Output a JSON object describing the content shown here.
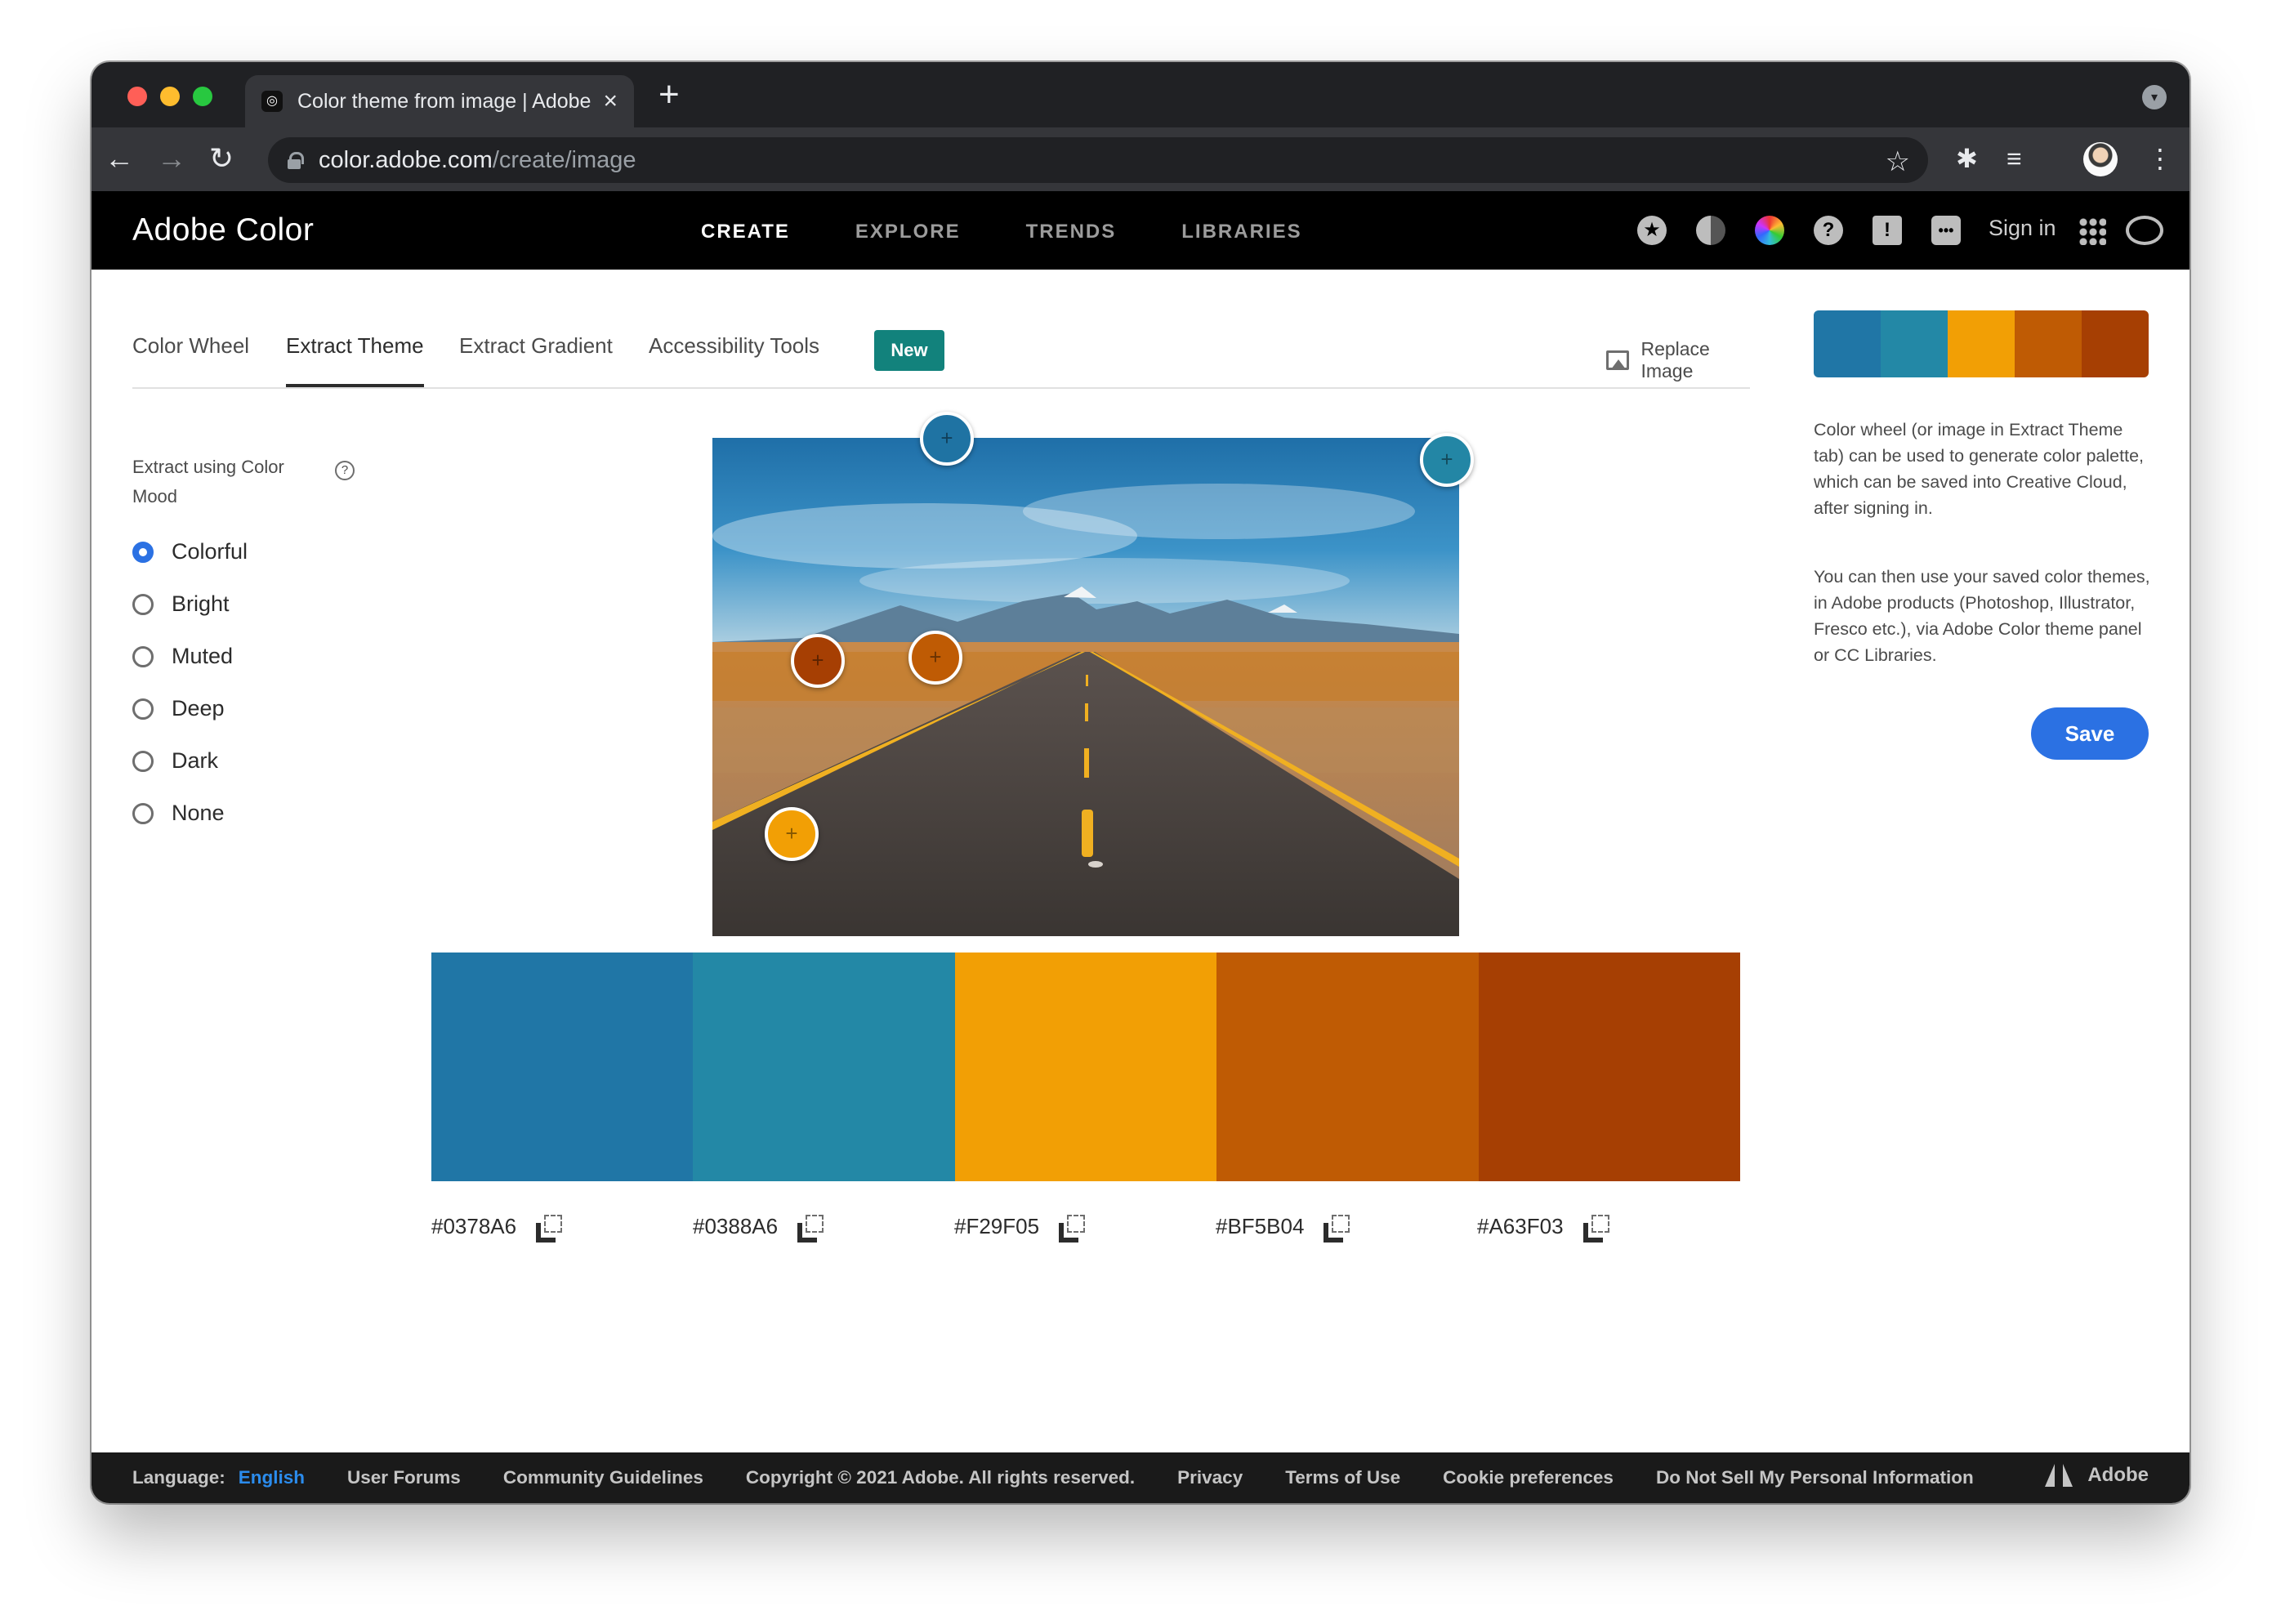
{
  "browser": {
    "tab_title": "Color theme from image | Adobe Color",
    "tab_favicon": "adobe-color-icon",
    "new_tab_label": "+",
    "url_host": "color.adobe.com",
    "url_path": "/create/image"
  },
  "header": {
    "brand": "Adobe Color",
    "nav": [
      "CREATE",
      "EXPLORE",
      "TRENDS",
      "LIBRARIES"
    ],
    "active_nav": "CREATE",
    "sign_in": "Sign in",
    "icons": [
      "star-badge-icon",
      "moon-icon",
      "color-wheel-icon",
      "help-icon",
      "feedback-icon",
      "chat-icon",
      "apps-grid-icon",
      "creative-cloud-icon"
    ]
  },
  "subtabs": {
    "items": [
      "Color Wheel",
      "Extract Theme",
      "Extract Gradient",
      "Accessibility Tools"
    ],
    "active": "Extract Theme",
    "new_badge": "New",
    "replace_image": "Replace Image"
  },
  "mood": {
    "label": "Extract using Color Mood",
    "help": "?",
    "options": [
      "Colorful",
      "Bright",
      "Muted",
      "Deep",
      "Dark",
      "None"
    ],
    "selected": "Colorful"
  },
  "theme": {
    "colors": [
      "#2076A6",
      "#2388A6",
      "#F29F05",
      "#BF5B04",
      "#A63F03"
    ],
    "hex_labels": [
      "#0378A6",
      "#0388A6",
      "#F29F05",
      "#BF5B04",
      "#A63F03"
    ]
  },
  "markers": {
    "symbol": "+",
    "colors": [
      "#1f73a3",
      "#2386a5",
      "#f29f05",
      "#bf5b04",
      "#a63f03"
    ]
  },
  "right_panel": {
    "info_1": "Color wheel (or image in Extract Theme tab) can be used to generate color palette, which can be saved into Creative Cloud, after signing in.",
    "info_2": "You can then use your saved color themes, in Adobe products (Photoshop, Illustrator, Fresco etc.), via Adobe Color theme panel or CC Libraries.",
    "save": "Save"
  },
  "footer": {
    "language_label": "Language:",
    "language": "English",
    "links": [
      "User Forums",
      "Community Guidelines",
      "Copyright © 2021 Adobe. All rights reserved.",
      "Privacy",
      "Terms of Use",
      "Cookie preferences",
      "Do Not Sell My Personal Information"
    ],
    "adobe": "Adobe"
  }
}
